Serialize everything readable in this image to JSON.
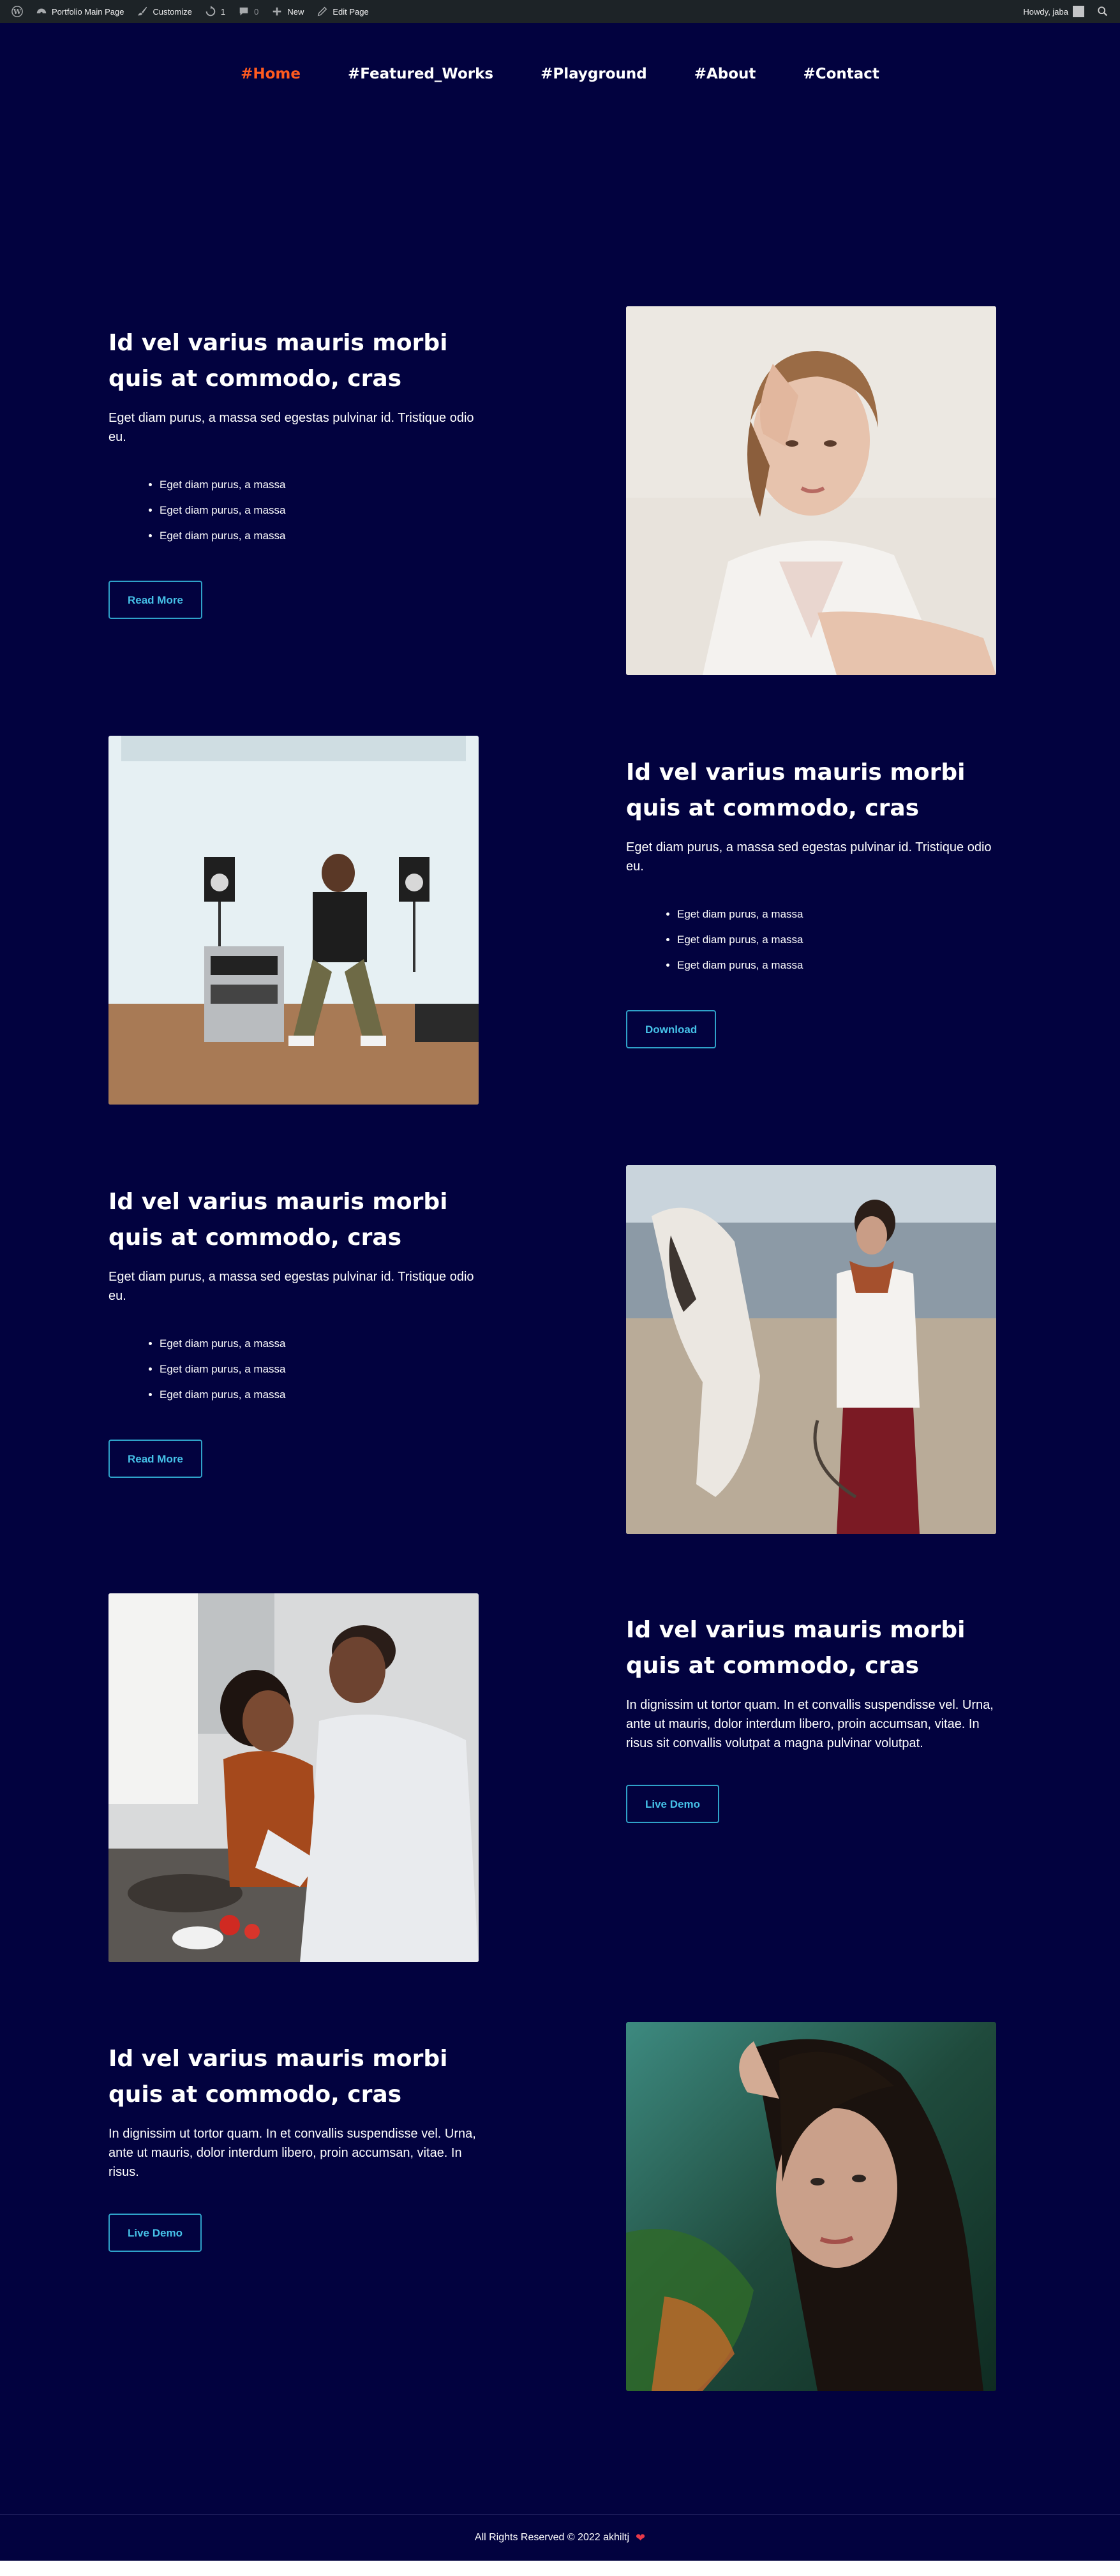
{
  "adminbar": {
    "site_name": "Portfolio Main Page",
    "customize": "Customize",
    "updates_count": "1",
    "comments_count": "0",
    "new_label": "New",
    "edit_page": "Edit Page",
    "greeting": "Howdy, jaba"
  },
  "nav": {
    "items": [
      "#Home",
      "#Featured_Works",
      "#Playground",
      "#About",
      "#Contact"
    ],
    "active_color": "#ff5a1f"
  },
  "sections": [
    {
      "heading": "Id vel varius mauris morbi quis at commodo, cras",
      "body": "Eget diam purus, a massa sed egestas pulvinar id. Tristique odio eu.",
      "bullets": [
        "Eget diam purus, a massa",
        "Eget diam purus, a massa",
        "Eget diam purus, a massa"
      ],
      "button": "Read More"
    },
    {
      "heading": "Id vel varius mauris morbi quis at commodo, cras",
      "body": "Eget diam purus, a massa sed egestas pulvinar id. Tristique odio eu.",
      "bullets": [
        "Eget diam purus, a massa",
        "Eget diam purus, a massa",
        "Eget diam purus, a massa"
      ],
      "button": "Download"
    },
    {
      "heading": "Id vel varius mauris morbi quis at commodo, cras",
      "body": "Eget diam purus, a massa sed egestas pulvinar id. Tristique odio eu.",
      "bullets": [
        "Eget diam purus, a massa",
        "Eget diam purus, a massa",
        "Eget diam purus, a massa"
      ],
      "button": "Read More"
    },
    {
      "heading": "Id vel varius mauris morbi quis at commodo, cras",
      "body": "In dignissim ut tortor quam. In et convallis suspendisse vel. Urna, ante ut mauris, dolor interdum libero, proin accumsan, vitae. In risus sit convallis volutpat a magna pulvinar volutpat.",
      "button": "Live Demo"
    },
    {
      "heading": "Id vel varius mauris morbi quis at commodo, cras",
      "body": "In dignissim ut tortor quam. In et convallis suspendisse vel. Urna, ante ut mauris, dolor interdum libero, proin accumsan, vitae. In risus.",
      "button": "Live Demo"
    }
  ],
  "footer": {
    "text": "All Rights Reserved © 2022 akhiltj",
    "heart": "❤"
  },
  "colors": {
    "background": "#02023f",
    "button_border": "#2fa2c9",
    "button_text": "#46c2e8"
  }
}
